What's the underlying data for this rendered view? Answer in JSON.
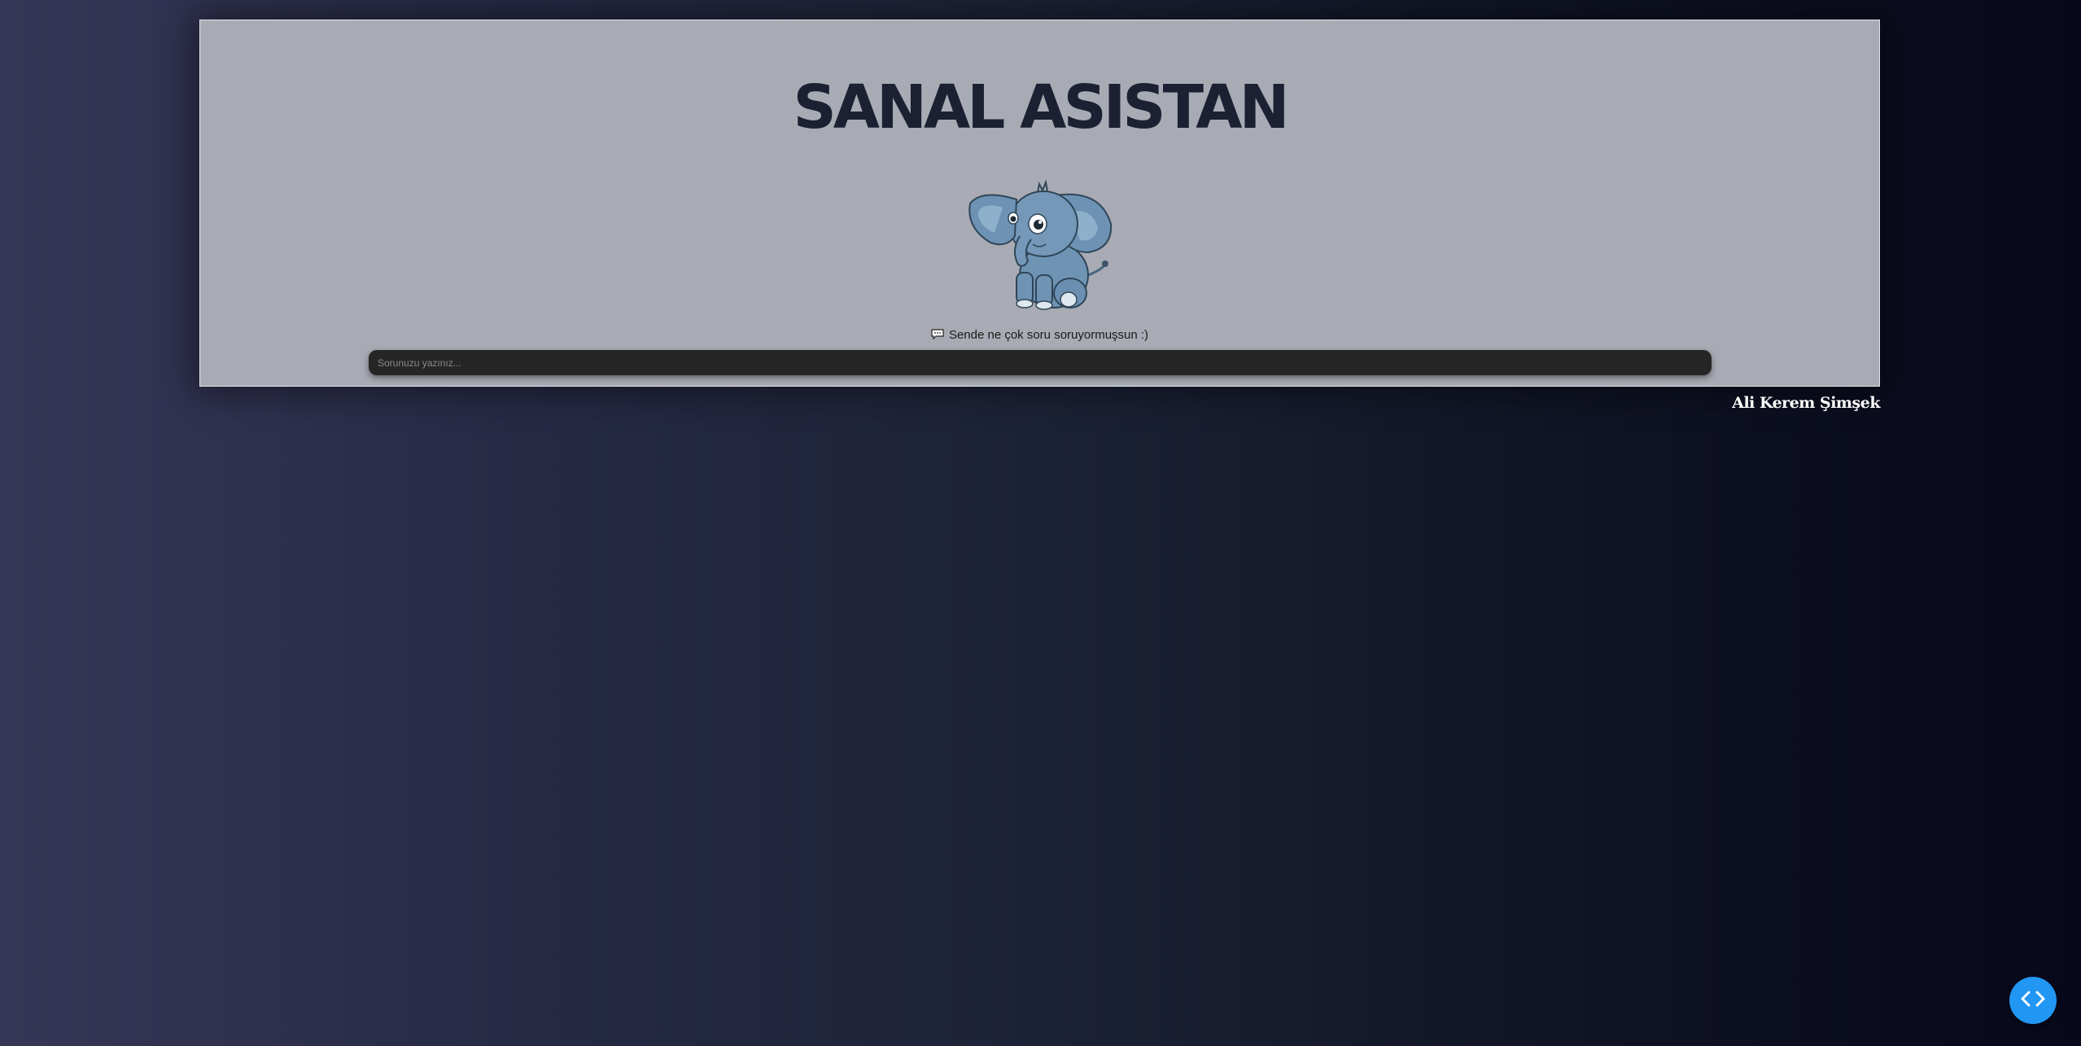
{
  "header": {
    "title": "SANAL ASISTAN"
  },
  "mascot": {
    "icon": "elephant-mascot"
  },
  "hint": {
    "icon": "speech-bubble-icon",
    "text": "Sende ne çok soru soruyormuşsun :)"
  },
  "question_input": {
    "placeholder": "Sorunuzu yazınız...",
    "value": ""
  },
  "footer": {
    "author": "Ali Kerem Şimşek"
  },
  "code_button": {
    "icon": "code-brackets-icon",
    "color": "#2196f3"
  },
  "colors": {
    "panel_bg": "#a9abb4",
    "title": "#1b2033",
    "input_bg": "#262626"
  }
}
